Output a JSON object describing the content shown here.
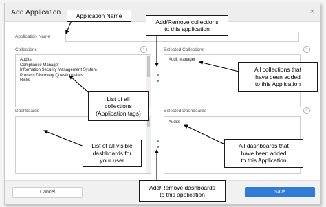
{
  "dialog": {
    "title": "Add Application",
    "close_icon": "×"
  },
  "form": {
    "application_name_label": "Application Name",
    "application_name_value": "",
    "collections_label": "Collections",
    "selected_collections_label": "Selected Collections",
    "dashboards_label": "Dashboards",
    "selected_dashboards_label": "Selected Dashboards",
    "info_icon": "i"
  },
  "collections": {
    "items": [
      "Audits",
      "Compliance Manager",
      "Information Security Management System",
      "Process Discovery Questionnaires",
      "Risks"
    ]
  },
  "selected_collections": {
    "items": [
      "Audit Manager"
    ]
  },
  "dashboards": {
    "items": []
  },
  "selected_dashboards": {
    "items": [
      "Audits"
    ]
  },
  "footer": {
    "cancel_label": "Cancel",
    "save_label": "Save"
  },
  "callouts": {
    "application_name": "Application Name",
    "add_remove_collections": [
      "Add/Remove collections",
      "to this application"
    ],
    "all_collections_added": [
      "All collections that",
      "have been added",
      "to this Application"
    ],
    "list_all_collections": [
      "List of all",
      "collections",
      "(Application tags)"
    ],
    "list_visible_dashboards": [
      "List of all visible",
      "dashboards for",
      "your user"
    ],
    "all_dashboards_added": [
      "All dashboards that",
      "have been added",
      "to this Application"
    ],
    "add_remove_dashboards": [
      "Add/Remove dashboards",
      "to this application"
    ]
  },
  "colors": {
    "save_button": "#2f7bd6",
    "accent_dots": "#4a90d9"
  }
}
